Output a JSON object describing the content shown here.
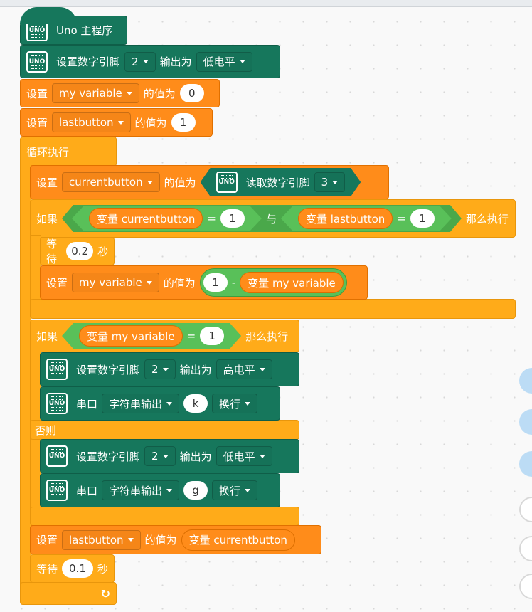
{
  "board": "UNO",
  "colors": {
    "board": "#16775c",
    "variable": "#ff8c1a",
    "control": "#ffab19",
    "operator": "#59c059"
  },
  "hat": {
    "label": "Uno 主程序"
  },
  "b1": {
    "label": "设置数字引脚",
    "pin": "2",
    "mid": "输出为",
    "level": "低电平"
  },
  "b2": {
    "set": "设置",
    "var": "my variable",
    "mid": "的值为",
    "value": "0"
  },
  "b3": {
    "set": "设置",
    "var": "lastbutton",
    "mid": "的值为",
    "value": "1"
  },
  "loop": {
    "label": "循环执行"
  },
  "b4": {
    "set": "设置",
    "var": "currentbutton",
    "mid": "的值为",
    "reader": "读取数字引脚",
    "pin": "3"
  },
  "if1": {
    "if": "如果",
    "lhs": "变量 currentbutton",
    "eq": "=",
    "v1": "1",
    "and": "与",
    "rhs": "变量 lastbutton",
    "v2": "1",
    "then": "那么执行"
  },
  "wait1": {
    "label": "等待",
    "value": "0.2",
    "unit": "秒"
  },
  "b5": {
    "set": "设置",
    "var": "my variable",
    "mid": "的值为",
    "a": "1",
    "op": "-",
    "rep": "变量 my variable"
  },
  "if2": {
    "if": "如果",
    "lhs": "变量 my variable",
    "eq": "=",
    "v": "1",
    "then": "那么执行",
    "else": "否则"
  },
  "b6": {
    "label": "设置数字引脚",
    "pin": "2",
    "mid": "输出为",
    "level": "高电平"
  },
  "s1": {
    "label": "串口",
    "mode": "字符串输出",
    "text": "k",
    "nl": "换行"
  },
  "b7": {
    "label": "设置数字引脚",
    "pin": "2",
    "mid": "输出为",
    "level": "低电平"
  },
  "s2": {
    "label": "串口",
    "mode": "字符串输出",
    "text": "g",
    "nl": "换行"
  },
  "b8": {
    "set": "设置",
    "var": "lastbutton",
    "mid": "的值为",
    "rep": "变量 currentbutton"
  },
  "wait2": {
    "label": "等待",
    "value": "0.1",
    "unit": "秒"
  },
  "loop_icon": "loop-arrow-icon",
  "side_buttons": [
    "undo-icon",
    "redo-icon",
    "delete-icon",
    "zoom-in-icon",
    "zoom-out-icon",
    "reset-zoom-icon"
  ]
}
